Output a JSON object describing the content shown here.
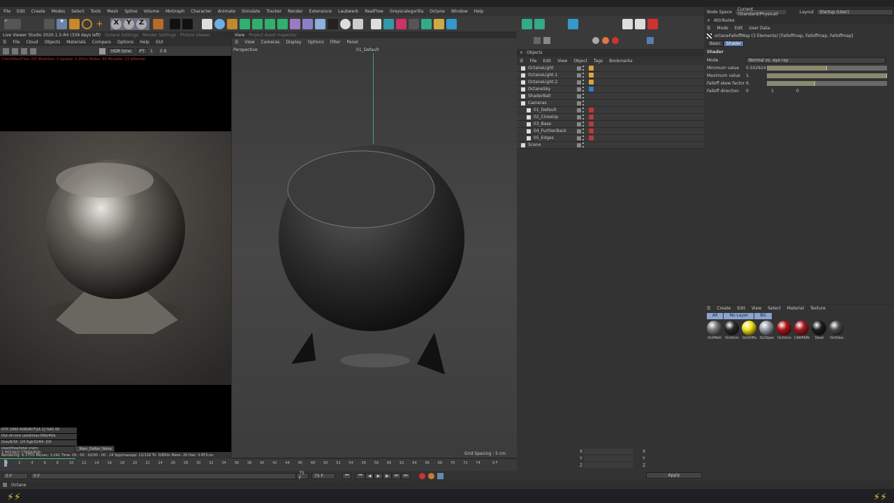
{
  "menu": [
    "File",
    "Edit",
    "Create",
    "Modes",
    "Select",
    "Tools",
    "Mesh",
    "Spline",
    "Volume",
    "MoGraph",
    "Character",
    "Animate",
    "Simulate",
    "Tracker",
    "Render",
    "Extensions",
    "Laubwerk",
    "RealFlow",
    "Greyscalegorilla",
    "Octane",
    "Window",
    "Help"
  ],
  "toolbar_axes": [
    "X",
    "Y",
    "Z"
  ],
  "live_viewer": {
    "title": "Live Viewer Studio 2020.1.5-R4 (339 days left)",
    "tabs": [
      "Octane Settings",
      "Render Settings",
      "Picture Viewer"
    ],
    "menu": [
      "File",
      "Cloud",
      "Objects",
      "Materials",
      "Compare",
      "Options",
      "Help",
      "GUI"
    ],
    "mode": "HDR tone",
    "pt": "PT",
    "value_a": "1",
    "value_b": "0.8",
    "status_line": "Checkfiles/Time: 0/0 MeshGen: 0  Update: 0.20ms  Nodes: 44  Movable: 23 leftsmall",
    "stats": [
      "GTX 1060 6GB(RDT)[4.1]    %81    65",
      "Out-of-core used/max:0Kb/4Gb",
      "Grey8/16: 1/0          Rgb32/64: 0/0",
      "Used/free/total vram: 1.901Gb/2.779Gb/6Gb"
    ],
    "aov": "_Main_DeNer_Noise",
    "rendering": "Rendering: 9.175%  Ms/sec: 3.241  Time: 00 : 00 : 02/00 : 00 : 24  Spp/maxspp: 12/128   Tri: 0/891k  Mesh: 26   Hair: 0   RTX:on",
    "progress": 0.09
  },
  "viewport": {
    "tabs": [
      "View",
      "Project Asset Inspector"
    ],
    "menu": [
      "View",
      "Cameras",
      "Display",
      "Options",
      "Filter",
      "Panel"
    ],
    "label": "Perspective",
    "camera": "01_Default",
    "grid_spacing": "Grid Spacing : 5 cm"
  },
  "objects": {
    "title": "Objects",
    "menu": [
      "File",
      "Edit",
      "View",
      "Object",
      "Tags",
      "Bookmarks"
    ],
    "items": [
      {
        "name": "OctaneLight",
        "tag": "light",
        "indent": 0
      },
      {
        "name": "OctaneLight.1",
        "tag": "light",
        "indent": 0
      },
      {
        "name": "OctaneLight.2",
        "tag": "light",
        "indent": 0
      },
      {
        "name": "OctaneSky",
        "tag": "sky",
        "indent": 0
      },
      {
        "name": "ShaderBall",
        "tag": "",
        "indent": 0
      },
      {
        "name": "Cameras",
        "tag": "",
        "indent": 0
      },
      {
        "name": "01_Default",
        "tag": "camera",
        "indent": 1
      },
      {
        "name": "02_CloseUp",
        "tag": "camera",
        "indent": 1
      },
      {
        "name": "03_Base",
        "tag": "camera",
        "indent": 1
      },
      {
        "name": "04_FurtherBack",
        "tag": "camera",
        "indent": 1
      },
      {
        "name": "05_Edges",
        "tag": "camera",
        "indent": 1
      },
      {
        "name": "Scene",
        "tag": "",
        "indent": 0
      }
    ],
    "colors": {
      "light": "#d9a23c",
      "sky": "#2e7fc4",
      "camera": "#b83a3a"
    }
  },
  "attributes": {
    "node_space_label": "Node Space",
    "node_space": "Current (Standard/Physical)",
    "layout_label": "Layout",
    "layout": "Startup (User)",
    "title": "Attributes",
    "menu": [
      "Mode",
      "Edit",
      "User Data"
    ],
    "object": "octaneFalloffMap (3 Elements) [Falloffmap, Falloffmap, Falloffmap]",
    "tabs": [
      "Basic",
      "Shader"
    ],
    "section": "Shader",
    "fields": [
      {
        "label": "Mode",
        "value": "Normal vs. eye ray"
      },
      {
        "label": "Minimum value",
        "value": "0.502924",
        "fill": 0.5
      },
      {
        "label": "Maximum value",
        "value": "1.",
        "fill": 1
      },
      {
        "label": "Falloff skew factor",
        "value": "6.",
        "fill": 0.4
      }
    ],
    "falloff_direction": {
      "label": "Falloff direction",
      "x": "0",
      "y": "1",
      "z": "0"
    }
  },
  "materials": {
    "menu": [
      "Create",
      "Edit",
      "View",
      "Select",
      "Material",
      "Texture"
    ],
    "filters": [
      "All",
      "No Layer",
      "BG"
    ],
    "items": [
      {
        "name": "OctMetl",
        "color": "#7a7a7a"
      },
      {
        "name": "OctUniv",
        "color": "#2a2a2a"
      },
      {
        "name": "OctDiffu",
        "color": "#f2e21a"
      },
      {
        "name": "OctSpec",
        "color": "#9aa0a8"
      },
      {
        "name": "OctUniv",
        "color": "#b31515"
      },
      {
        "name": "CARPAIN",
        "color": "#a51a22"
      },
      {
        "name": "Steel",
        "color": "#1e1e1e"
      },
      {
        "name": "OctGlos",
        "color": "#4a4a4a"
      }
    ]
  },
  "timeline": {
    "ticks": [
      "0",
      "2",
      "4",
      "6",
      "8",
      "10",
      "12",
      "14",
      "16",
      "18",
      "20",
      "22",
      "24",
      "26",
      "28",
      "30",
      "32",
      "34",
      "36",
      "38",
      "40",
      "42",
      "44",
      "46",
      "48",
      "50",
      "52",
      "54",
      "56",
      "58",
      "60",
      "62",
      "64",
      "66",
      "68",
      "70",
      "72",
      "74"
    ],
    "current": "0 F",
    "start": "0 F",
    "start2": "0 F",
    "end": "75 F",
    "end2": "75 F",
    "frame_field": "0 F"
  },
  "coords": {
    "axes": [
      "X",
      "Y",
      "Z"
    ],
    "apply": "Apply"
  },
  "status": "Octane"
}
